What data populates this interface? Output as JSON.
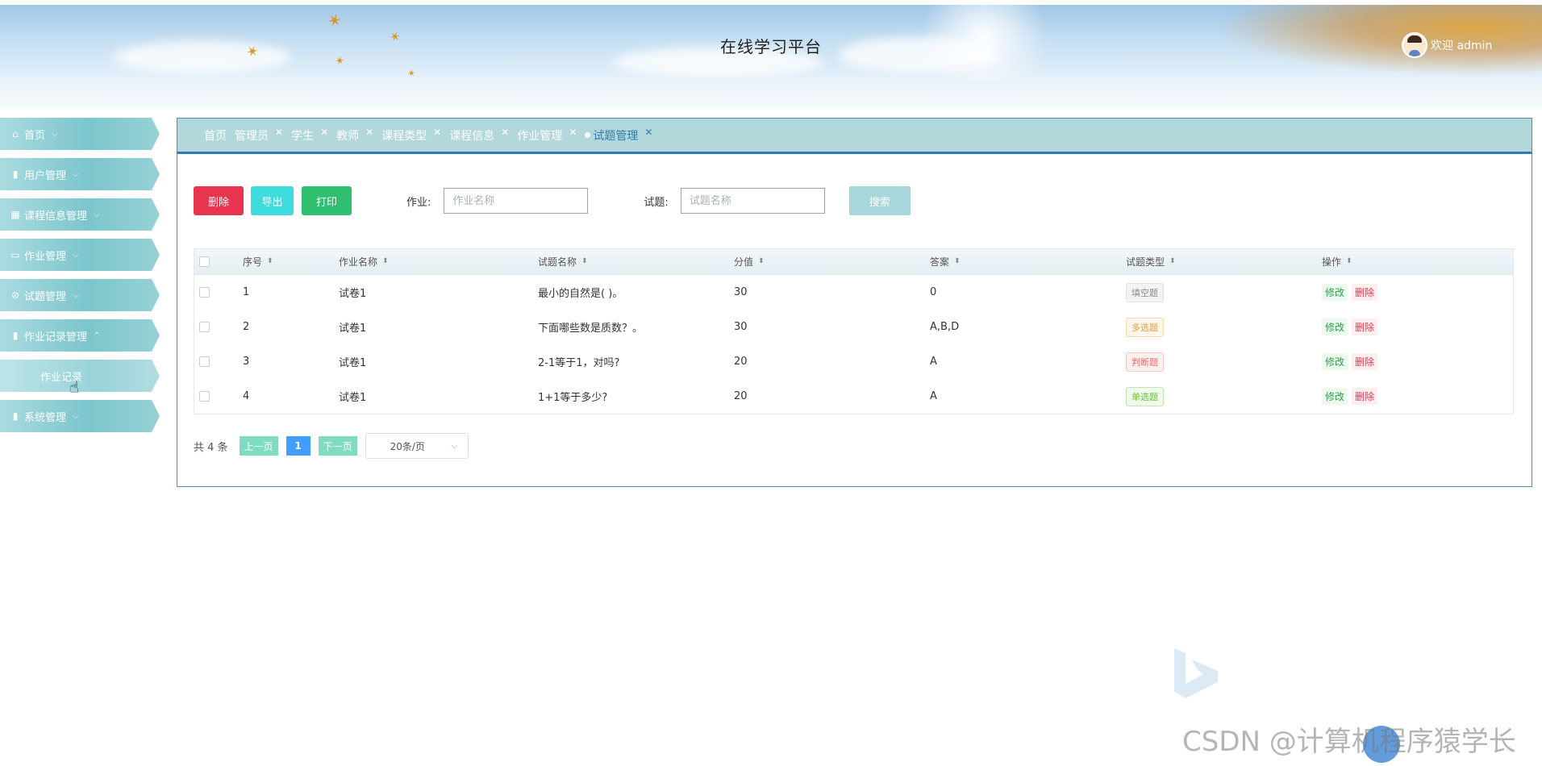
{
  "header": {
    "title": "在线学习平台",
    "welcome": "欢迎 admin"
  },
  "sidebar": {
    "items": [
      {
        "label": "首页",
        "icon": "home-icon",
        "glyph": "⌂",
        "chevron": "⌵"
      },
      {
        "label": "用户管理",
        "icon": "user-manage-icon",
        "glyph": "▮",
        "chevron": "⌵"
      },
      {
        "label": "课程信息管理",
        "icon": "course-icon",
        "glyph": "▦",
        "chevron": "⌵"
      },
      {
        "label": "作业管理",
        "icon": "homework-icon",
        "glyph": "▭",
        "chevron": "⌵"
      },
      {
        "label": "试题管理",
        "icon": "question-icon",
        "glyph": "⊘",
        "chevron": "⌵"
      },
      {
        "label": "作业记录管理",
        "icon": "record-icon",
        "glyph": "▮",
        "chevron": "⌃"
      },
      {
        "label": "作业记录",
        "sub": true
      },
      {
        "label": "系统管理",
        "icon": "system-icon",
        "glyph": "▮",
        "chevron": "⌵"
      }
    ]
  },
  "tabs": [
    {
      "label": "首页",
      "closable": false
    },
    {
      "label": "管理员",
      "closable": true
    },
    {
      "label": "学生",
      "closable": true
    },
    {
      "label": "教师",
      "closable": true
    },
    {
      "label": "课程类型",
      "closable": true
    },
    {
      "label": "课程信息",
      "closable": true
    },
    {
      "label": "作业管理",
      "closable": true
    },
    {
      "label": "试题管理",
      "closable": true,
      "active": true
    }
  ],
  "toolbar": {
    "delete_label": "删除",
    "export_label": "导出",
    "print_label": "打印",
    "homework_label": "作业:",
    "homework_placeholder": "作业名称",
    "question_label": "试题:",
    "question_placeholder": "试题名称",
    "search_label": "搜索"
  },
  "table": {
    "columns": [
      "序号",
      "作业名称",
      "试题名称",
      "分值",
      "答案",
      "试题类型",
      "操作"
    ],
    "rows": [
      {
        "seq": "1",
        "homework": "试卷1",
        "question": "最小的自然是( )。",
        "score": "30",
        "answer": "0",
        "type": "填空题",
        "type_color": "gray"
      },
      {
        "seq": "2",
        "homework": "试卷1",
        "question": "下面哪些数是质数？。",
        "score": "30",
        "answer": "A,B,D",
        "type": "多选题",
        "type_color": "orange"
      },
      {
        "seq": "3",
        "homework": "试卷1",
        "question": "2-1等于1，对吗?",
        "score": "20",
        "answer": "A",
        "type": "判断题",
        "type_color": "red"
      },
      {
        "seq": "4",
        "homework": "试卷1",
        "question": "1+1等于多少?",
        "score": "20",
        "answer": "A",
        "type": "单选题",
        "type_color": "green"
      }
    ],
    "edit_label": "修改",
    "delete_label": "删除"
  },
  "pagination": {
    "total_text": "共 4 条",
    "prev_label": "上一页",
    "current_page": "1",
    "next_label": "下一页",
    "page_size": "20条/页"
  },
  "watermark": "CSDN @计算机程序猿学长",
  "colors": {
    "accent": "#2f7bb0",
    "sidebar": "#7cc5cc",
    "delete": "#e8344e",
    "export": "#3fdcde",
    "print": "#2fbf71"
  }
}
